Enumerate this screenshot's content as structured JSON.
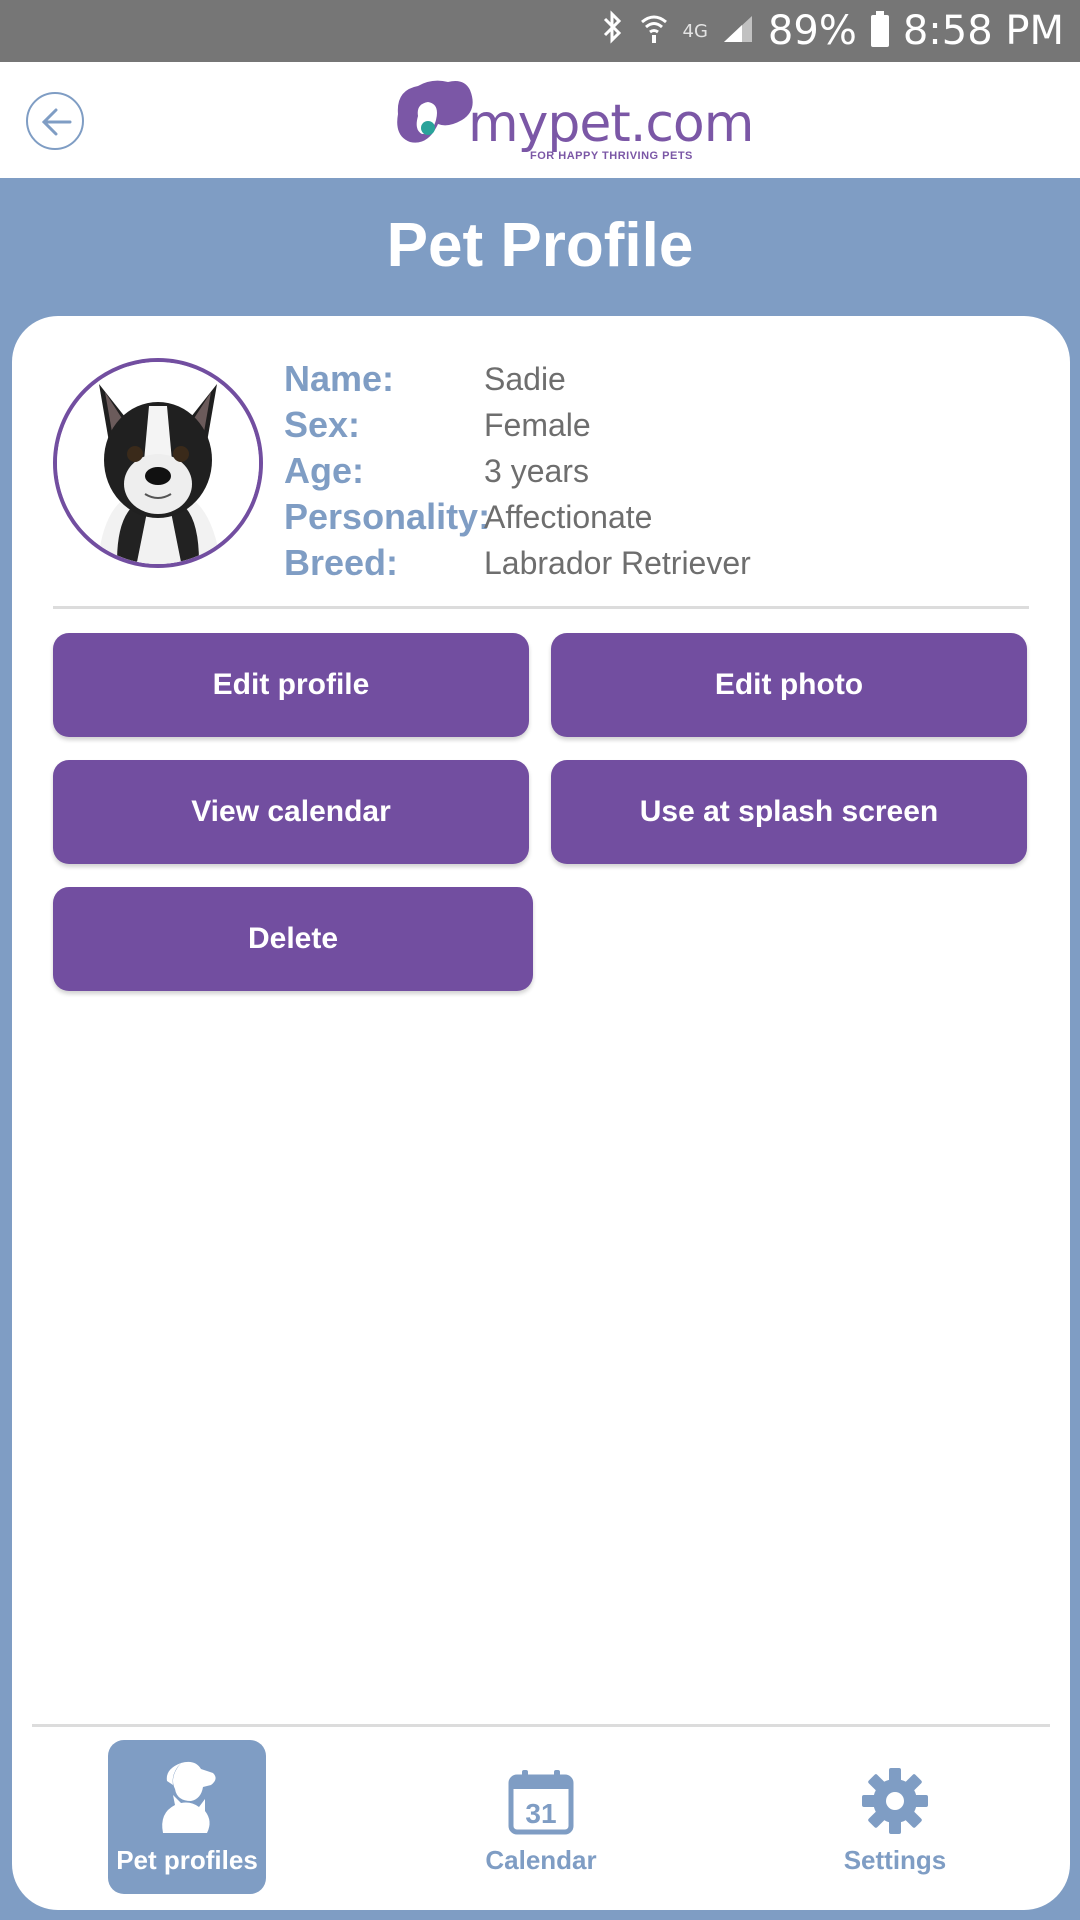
{
  "status": {
    "battery": "89%",
    "time": "8:58 PM",
    "network": "4G"
  },
  "app": {
    "logo_text": "mypet.com",
    "logo_tagline": "FOR HAPPY THRIVING PETS",
    "page_title": "Pet Profile"
  },
  "profile": {
    "fields": [
      {
        "label": "Name:",
        "value": "Sadie"
      },
      {
        "label": "Sex:",
        "value": "Female"
      },
      {
        "label": "Age:",
        "value": "3 years"
      },
      {
        "label": "Personality:",
        "value": "Affectionate"
      },
      {
        "label": "Breed:",
        "value": "Labrador Retriever"
      }
    ]
  },
  "actions": {
    "edit_profile": "Edit profile",
    "edit_photo": "Edit photo",
    "view_calendar": "View calendar",
    "use_splash": "Use at splash screen",
    "delete": "Delete"
  },
  "nav": {
    "items": [
      {
        "label": "Pet profiles",
        "icon": "pets-icon",
        "active": true
      },
      {
        "label": "Calendar",
        "icon": "calendar-icon",
        "active": false,
        "day": "31"
      },
      {
        "label": "Settings",
        "icon": "gear-icon",
        "active": false
      }
    ]
  },
  "colors": {
    "accent_purple": "#724ea0",
    "accent_blue": "#7f9dc4",
    "status_bar": "#767676"
  }
}
